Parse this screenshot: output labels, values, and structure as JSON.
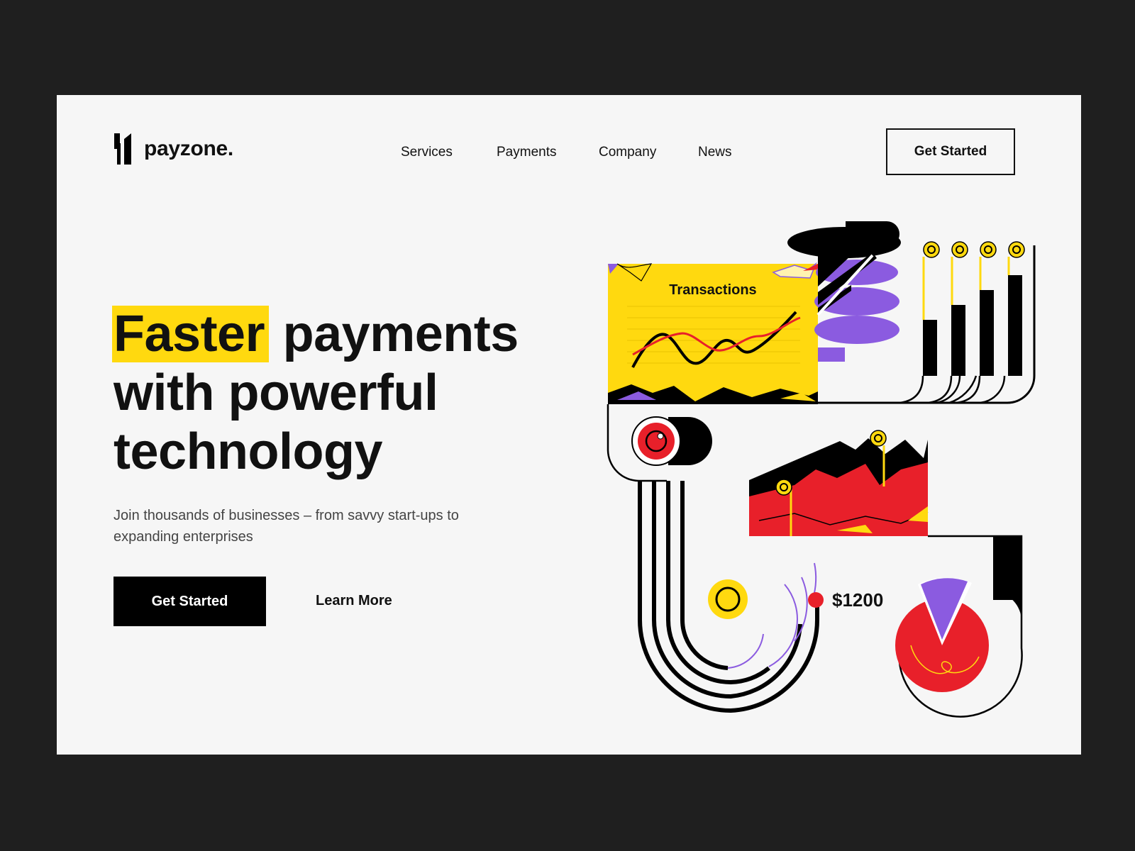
{
  "brand": {
    "name": "payzone.",
    "logo_icon": "payzone-logo-icon"
  },
  "nav": {
    "items": [
      {
        "label": "Services"
      },
      {
        "label": "Payments"
      },
      {
        "label": "Company"
      },
      {
        "label": "News"
      }
    ],
    "cta_label": "Get Started"
  },
  "hero": {
    "headline_highlight": "Faster",
    "headline_rest_1": "payments",
    "headline_line_2": "with powerful",
    "headline_line_3": "technology",
    "subtext": "Join thousands of businesses – from savvy start-ups to expanding enterprises",
    "primary_cta": "Get Started",
    "secondary_cta": "Learn More"
  },
  "illustration": {
    "card_title": "Transactions",
    "amount": "$1200"
  },
  "colors": {
    "accent_yellow": "#ffd90f",
    "accent_red": "#e8202a",
    "accent_purple": "#8b5be0",
    "ink": "#000000",
    "page_bg": "#f6f6f6",
    "frame_bg": "#1f1f1f"
  }
}
